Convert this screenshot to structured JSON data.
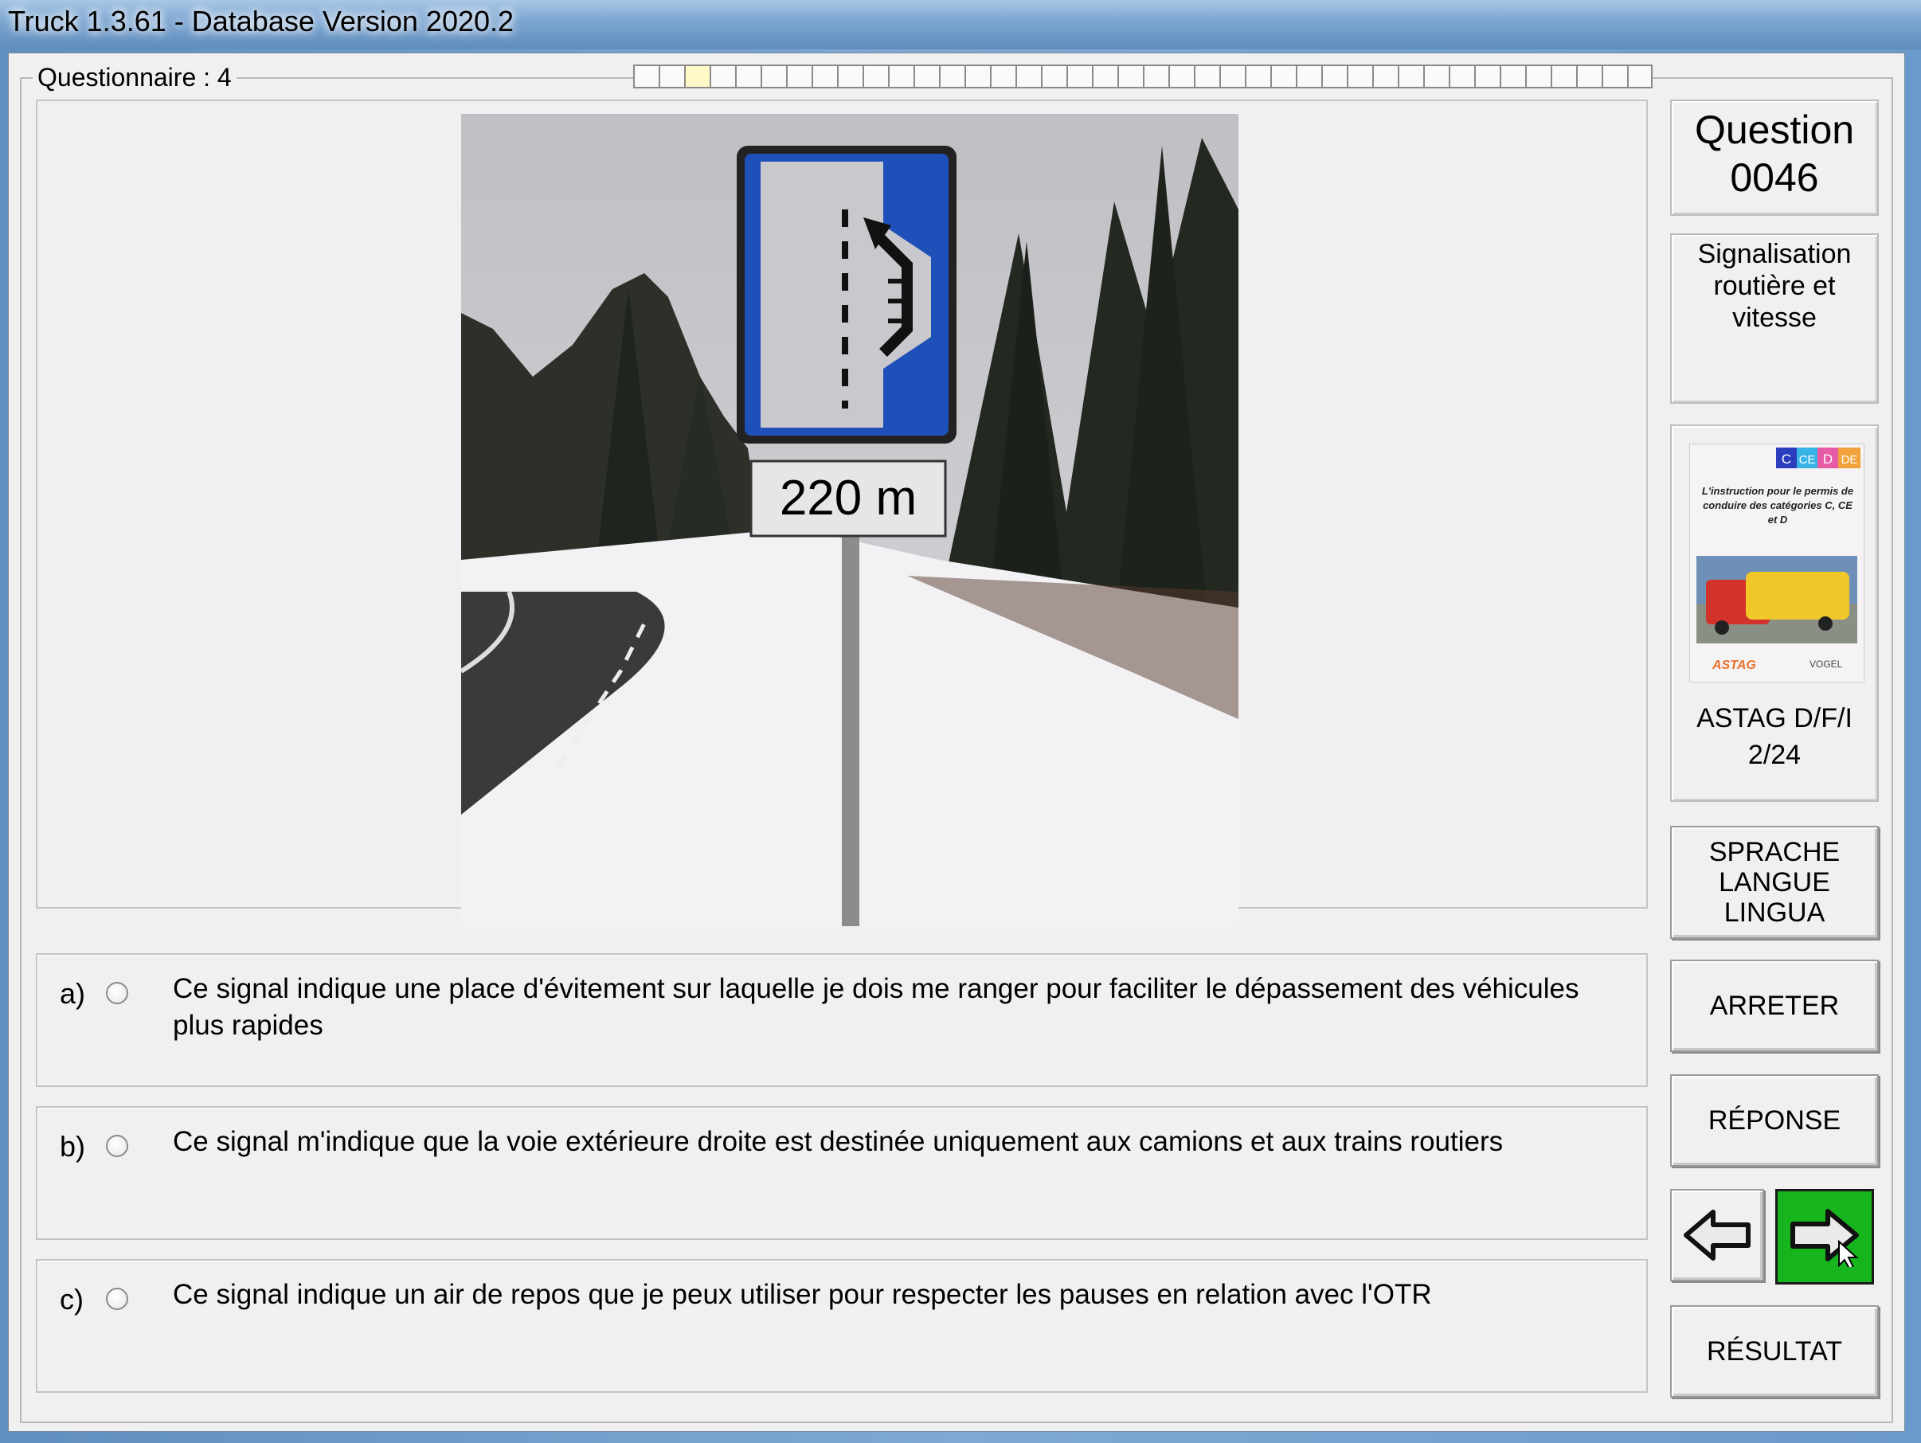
{
  "window": {
    "title": "Truck 1.3.61 - Database Version 2020.2"
  },
  "questionnaire": {
    "label": "Questionnaire : 4"
  },
  "photo": {
    "sign_distance": "220 m"
  },
  "answers": [
    {
      "letter": "a)",
      "text": "Ce signal indique une place d'évitement sur laquelle je dois me ranger pour faciliter le dépassement des véhicules plus rapides"
    },
    {
      "letter": "b)",
      "text": "Ce signal m'indique que la voie extérieure droite est destinée uniquement aux camions et aux trains routiers"
    },
    {
      "letter": "c)",
      "text": "Ce signal indique un air de repos que je peux utiliser pour respecter les pauses en relation avec l'OTR"
    }
  ],
  "sidebar": {
    "question_title": "Question",
    "question_number": "0046",
    "category": "Signalisation routière et vitesse",
    "book": {
      "badges": [
        "C",
        "CE",
        "D",
        "DE"
      ],
      "cover_text": "L'instruction pour le permis de conduire des catégories C, CE et D",
      "publisher_left": "ASTAG",
      "publisher_right": "VOGEL",
      "label_line1": "ASTAG D/F/I",
      "label_line2": "2/24"
    },
    "language_button": "SPRACHE\nLANGUE\nLINGUA",
    "stop_button": "ARRETER",
    "answer_button": "RÉPONSE",
    "result_button": "RÉSULTAT"
  }
}
